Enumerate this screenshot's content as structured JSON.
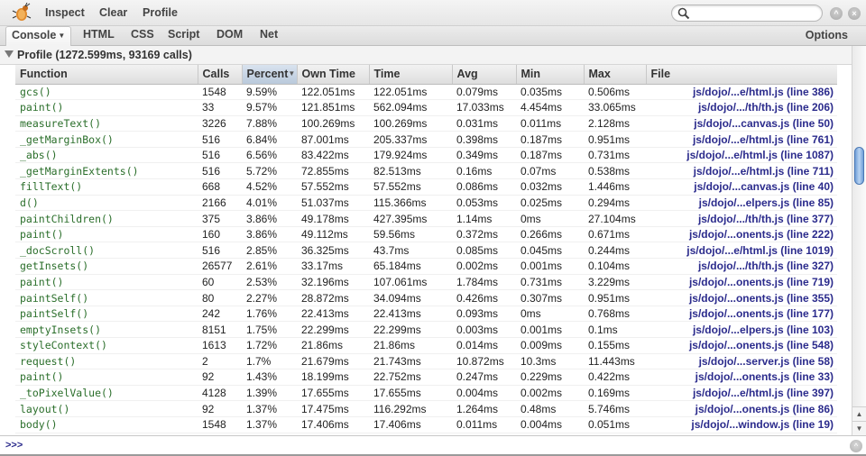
{
  "toolbar": {
    "inspect_label": "Inspect",
    "clear_label": "Clear",
    "profile_label": "Profile",
    "search": {
      "value": "",
      "placeholder": ""
    }
  },
  "tabs": [
    {
      "label": "Console",
      "active": true
    },
    {
      "label": "HTML"
    },
    {
      "label": "CSS"
    },
    {
      "label": "Script"
    },
    {
      "label": "DOM"
    },
    {
      "label": "Net"
    }
  ],
  "options_label": "Options",
  "profile": {
    "title": "Profile (1272.599ms, 93169 calls)",
    "sorted_column": "Percent",
    "columns": [
      "Function",
      "Calls",
      "Percent",
      "Own Time",
      "Time",
      "Avg",
      "Min",
      "Max",
      "File"
    ],
    "rows": [
      [
        "gcs()",
        "1548",
        "9.59%",
        "122.051ms",
        "122.051ms",
        "0.079ms",
        "0.035ms",
        "0.506ms",
        "js/dojo/...e/html.js (line 386)"
      ],
      [
        "paint()",
        "33",
        "9.57%",
        "121.851ms",
        "562.094ms",
        "17.033ms",
        "4.454ms",
        "33.065ms",
        "js/dojo/.../th/th.js (line 206)"
      ],
      [
        "measureText()",
        "3226",
        "7.88%",
        "100.269ms",
        "100.269ms",
        "0.031ms",
        "0.011ms",
        "2.128ms",
        "js/dojo/...canvas.js (line 50)"
      ],
      [
        "_getMarginBox()",
        "516",
        "6.84%",
        "87.001ms",
        "205.337ms",
        "0.398ms",
        "0.187ms",
        "0.951ms",
        "js/dojo/...e/html.js (line 761)"
      ],
      [
        "_abs()",
        "516",
        "6.56%",
        "83.422ms",
        "179.924ms",
        "0.349ms",
        "0.187ms",
        "0.731ms",
        "js/dojo/...e/html.js (line 1087)"
      ],
      [
        "_getMarginExtents()",
        "516",
        "5.72%",
        "72.855ms",
        "82.513ms",
        "0.16ms",
        "0.07ms",
        "0.538ms",
        "js/dojo/...e/html.js (line 711)"
      ],
      [
        "fillText()",
        "668",
        "4.52%",
        "57.552ms",
        "57.552ms",
        "0.086ms",
        "0.032ms",
        "1.446ms",
        "js/dojo/...canvas.js (line 40)"
      ],
      [
        "d()",
        "2166",
        "4.01%",
        "51.037ms",
        "115.366ms",
        "0.053ms",
        "0.025ms",
        "0.294ms",
        "js/dojo/...elpers.js (line 85)"
      ],
      [
        "paintChildren()",
        "375",
        "3.86%",
        "49.178ms",
        "427.395ms",
        "1.14ms",
        "0ms",
        "27.104ms",
        "js/dojo/.../th/th.js (line 377)"
      ],
      [
        "paint()",
        "160",
        "3.86%",
        "49.112ms",
        "59.56ms",
        "0.372ms",
        "0.266ms",
        "0.671ms",
        "js/dojo/...onents.js (line 222)"
      ],
      [
        "_docScroll()",
        "516",
        "2.85%",
        "36.325ms",
        "43.7ms",
        "0.085ms",
        "0.045ms",
        "0.244ms",
        "js/dojo/...e/html.js (line 1019)"
      ],
      [
        "getInsets()",
        "26577",
        "2.61%",
        "33.17ms",
        "65.184ms",
        "0.002ms",
        "0.001ms",
        "0.104ms",
        "js/dojo/.../th/th.js (line 327)"
      ],
      [
        "paint()",
        "60",
        "2.53%",
        "32.196ms",
        "107.061ms",
        "1.784ms",
        "0.731ms",
        "3.229ms",
        "js/dojo/...onents.js (line 719)"
      ],
      [
        "paintSelf()",
        "80",
        "2.27%",
        "28.872ms",
        "34.094ms",
        "0.426ms",
        "0.307ms",
        "0.951ms",
        "js/dojo/...onents.js (line 355)"
      ],
      [
        "paintSelf()",
        "242",
        "1.76%",
        "22.413ms",
        "22.413ms",
        "0.093ms",
        "0ms",
        "0.768ms",
        "js/dojo/...onents.js (line 177)"
      ],
      [
        "emptyInsets()",
        "8151",
        "1.75%",
        "22.299ms",
        "22.299ms",
        "0.003ms",
        "0.001ms",
        "0.1ms",
        "js/dojo/...elpers.js (line 103)"
      ],
      [
        "styleContext()",
        "1613",
        "1.72%",
        "21.86ms",
        "21.86ms",
        "0.014ms",
        "0.009ms",
        "0.155ms",
        "js/dojo/...onents.js (line 548)"
      ],
      [
        "request()",
        "2",
        "1.7%",
        "21.679ms",
        "21.743ms",
        "10.872ms",
        "10.3ms",
        "11.443ms",
        "js/dojo/...server.js (line 58)"
      ],
      [
        "paint()",
        "92",
        "1.43%",
        "18.199ms",
        "22.752ms",
        "0.247ms",
        "0.229ms",
        "0.422ms",
        "js/dojo/...onents.js (line 33)"
      ],
      [
        "_toPixelValue()",
        "4128",
        "1.39%",
        "17.655ms",
        "17.655ms",
        "0.004ms",
        "0.002ms",
        "0.169ms",
        "js/dojo/...e/html.js (line 397)"
      ],
      [
        "layout()",
        "92",
        "1.37%",
        "17.475ms",
        "116.292ms",
        "1.264ms",
        "0.48ms",
        "5.746ms",
        "js/dojo/...onents.js (line 86)"
      ],
      [
        "body()",
        "1548",
        "1.37%",
        "17.406ms",
        "17.406ms",
        "0.011ms",
        "0.004ms",
        "0.051ms",
        "js/dojo/...window.js (line 19)"
      ]
    ]
  },
  "command_line": {
    "prompt": ">>>",
    "value": ""
  },
  "colors": {
    "function_text": "#2a6e2a",
    "file_link": "#2b2b8c",
    "sorted_header": "#c6d4e4",
    "scroll_thumb": "#8db6e6"
  },
  "icons": {
    "logo": "firebug-icon",
    "search": "search-icon",
    "prev": "chevron-up-icon",
    "close": "close-icon",
    "expand": "expand-up-icon"
  }
}
